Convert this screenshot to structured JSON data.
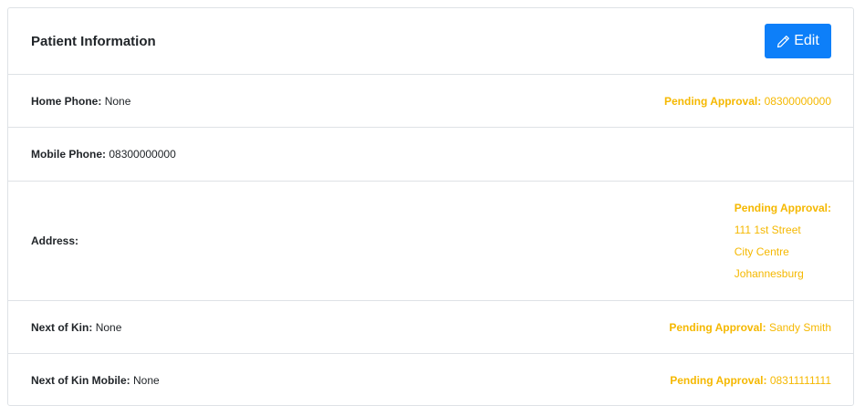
{
  "header": {
    "title": "Patient Information",
    "edit_label": "Edit"
  },
  "rows": {
    "home_phone": {
      "label": "Home Phone:",
      "value": "None",
      "pending_label": "Pending Approval:",
      "pending_value": "08300000000"
    },
    "mobile_phone": {
      "label": "Mobile Phone:",
      "value": "08300000000"
    },
    "address": {
      "label": "Address:",
      "pending_label": "Pending Approval:",
      "pending_lines": [
        "111 1st Street",
        "City Centre",
        "Johannesburg"
      ]
    },
    "next_of_kin": {
      "label": "Next of Kin:",
      "value": "None",
      "pending_label": "Pending Approval:",
      "pending_value": "Sandy Smith"
    },
    "next_of_kin_mobile": {
      "label": "Next of Kin Mobile:",
      "value": "None",
      "pending_label": "Pending Approval:",
      "pending_value": "08311111111"
    }
  },
  "colors": {
    "primary": "#0d7ff9",
    "pending": "#f5b800",
    "border": "#dee2e6"
  },
  "icons": {
    "edit": "pencil-icon"
  }
}
